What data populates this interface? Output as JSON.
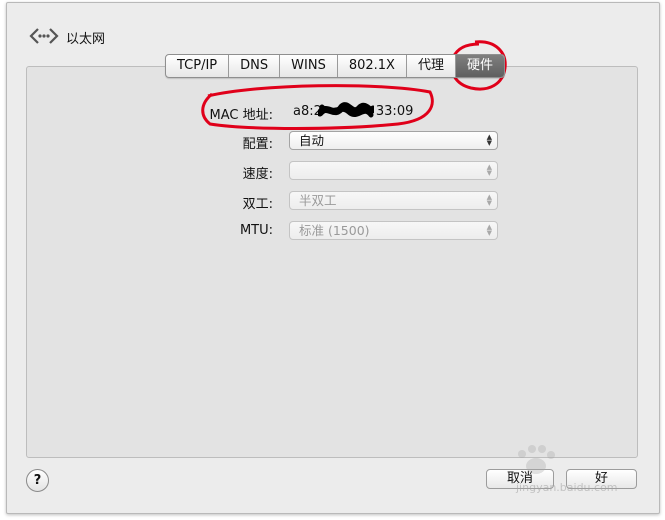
{
  "window": {
    "title": "以太网"
  },
  "tabs": [
    {
      "label": "TCP/IP",
      "selected": false
    },
    {
      "label": "DNS",
      "selected": false
    },
    {
      "label": "WINS",
      "selected": false
    },
    {
      "label": "802.1X",
      "selected": false
    },
    {
      "label": "代理",
      "selected": false
    },
    {
      "label": "硬件",
      "selected": true
    }
  ],
  "hardware": {
    "mac_label": "MAC 地址:",
    "mac_value_start": "a8:2",
    "mac_value_end": "33:09",
    "config_label": "配置:",
    "config_value": "自动",
    "speed_label": "速度:",
    "speed_value": "",
    "duplex_label": "双工:",
    "duplex_value": "半双工",
    "mtu_label": "MTU:",
    "mtu_value": "标准 (1500)"
  },
  "footer": {
    "help_label": "?",
    "cancel_label": "取消",
    "ok_label": "好"
  },
  "watermark": {
    "text": "jingyan.baidu.com"
  },
  "colors": {
    "annotation_red": "#e0001a",
    "selected_tab": "#6e6e6e"
  },
  "icons": [
    "back-arrows-icon",
    "popup-arrows-icon",
    "help-icon"
  ]
}
